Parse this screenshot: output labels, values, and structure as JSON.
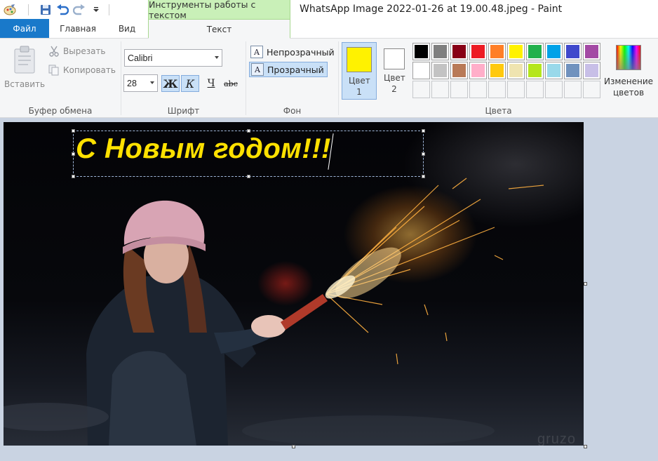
{
  "window": {
    "title": "WhatsApp Image 2022-01-26 at 19.00.48.jpeg - Paint",
    "context_tab_header": "Инструменты работы с текстом"
  },
  "quick_access": {
    "icons": [
      "paint-app-icon",
      "save-icon",
      "undo-icon",
      "redo-icon",
      "customize-dropdown-icon"
    ]
  },
  "tabs": {
    "file": "Файл",
    "home": "Главная",
    "view": "Вид",
    "text": "Текст"
  },
  "clipboard": {
    "paste": "Вставить",
    "cut": "Вырезать",
    "copy": "Копировать",
    "group_label": "Буфер обмена"
  },
  "font": {
    "family": "Calibri",
    "size": "28",
    "bold": "Ж",
    "italic": "К",
    "underline": "Ч",
    "strikethrough": "abc",
    "group_label": "Шрифт"
  },
  "background": {
    "opaque": "Непрозрачный",
    "transparent": "Прозрачный",
    "icon_letter": "A",
    "group_label": "Фон"
  },
  "colors": {
    "color1_label": "Цвет 1",
    "color2_label": "Цвет 2",
    "color1_value": "#fff200",
    "color2_value": "#ffffff",
    "edit_colors": "Изменение цветов",
    "group_label": "Цвета",
    "palette_row1": [
      "#000000",
      "#7f7f7f",
      "#880015",
      "#ed1c24",
      "#ff7f27",
      "#fff200",
      "#22b14c",
      "#00a2e8",
      "#3f48cc",
      "#a349a4"
    ],
    "palette_row2": [
      "#ffffff",
      "#c3c3c3",
      "#b97a57",
      "#ffaec9",
      "#ffc90e",
      "#efe4b0",
      "#b5e61d",
      "#99d9ea",
      "#7092be",
      "#c8bfe7"
    ]
  },
  "canvas": {
    "greeting_text": "С Новым годом!!!",
    "watermark": "gruzo"
  }
}
